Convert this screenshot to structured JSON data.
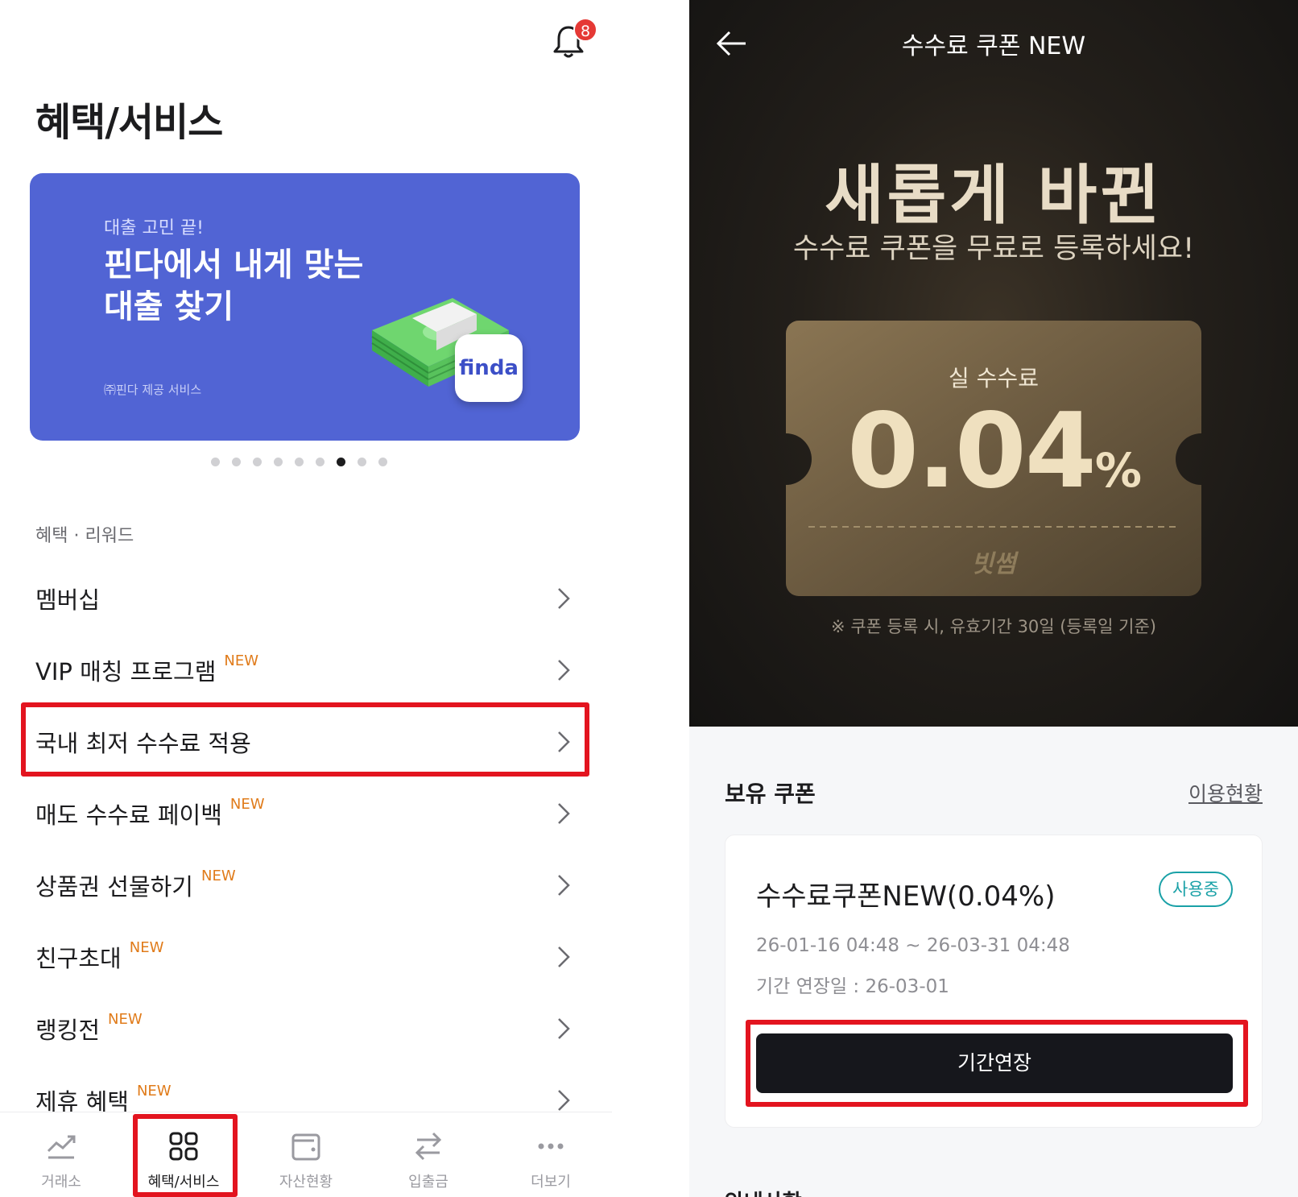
{
  "left": {
    "notification_count": "8",
    "page_title": "혜택/서비스",
    "banner": {
      "eyebrow": "대출 고민 끝!",
      "headline": "핀다에서 내게 맞는\n대출 찾기",
      "footnote": "㈜핀다 제공 서비스",
      "logo_text": "finda",
      "background_color": "#5164d4"
    },
    "carousel": {
      "total": 9,
      "active_index": 6
    },
    "section_label": "혜택 · 리워드",
    "menu": [
      {
        "label": "멤버십",
        "badge": ""
      },
      {
        "label": "VIP 매칭 프로그램",
        "badge": "NEW"
      },
      {
        "label": "국내 최저 수수료 적용",
        "badge": ""
      },
      {
        "label": "매도 수수료 페이백",
        "badge": "NEW"
      },
      {
        "label": "상품권 선물하기",
        "badge": "NEW"
      },
      {
        "label": "친구초대",
        "badge": "NEW"
      },
      {
        "label": "랭킹전",
        "badge": "NEW"
      },
      {
        "label": "제휴 혜택",
        "badge": "NEW"
      }
    ],
    "tabs": [
      {
        "label": "거래소",
        "icon": "chart-trend-icon"
      },
      {
        "label": "혜택/서비스",
        "icon": "grid-icon"
      },
      {
        "label": "자산현황",
        "icon": "wallet-icon"
      },
      {
        "label": "입출금",
        "icon": "transfer-arrows-icon"
      },
      {
        "label": "더보기",
        "icon": "more-dots-icon"
      }
    ],
    "active_tab": "혜택/서비스"
  },
  "right": {
    "header_title": "수수료 쿠폰 NEW",
    "hero_big": "새롭게 바뀐",
    "hero_sub": "수수료 쿠폰을 무료로 등록하세요!",
    "ticket": {
      "label": "실 수수료",
      "rate": "0.04",
      "unit": "%",
      "brand": "빗썸"
    },
    "ticket_note": "※ 쿠폰 등록 시, 유효기간 30일 (등록일 기준)",
    "coupons_title": "보유 쿠폰",
    "usage_link": "이용현황",
    "coupon": {
      "name": "수수료쿠폰NEW(0.04%)",
      "status": "사용중",
      "period": "26-01-16 04:48 ~ 26-03-31 04:48",
      "extension_date": "기간 연장일 : 26-03-01",
      "button_label": "기간연장"
    },
    "notice_title": "안내사항"
  },
  "colors": {
    "highlight": "#e3141f",
    "new_badge": "#e07b1a",
    "status_teal": "#1aa1a7",
    "button_dark": "#16171c"
  }
}
